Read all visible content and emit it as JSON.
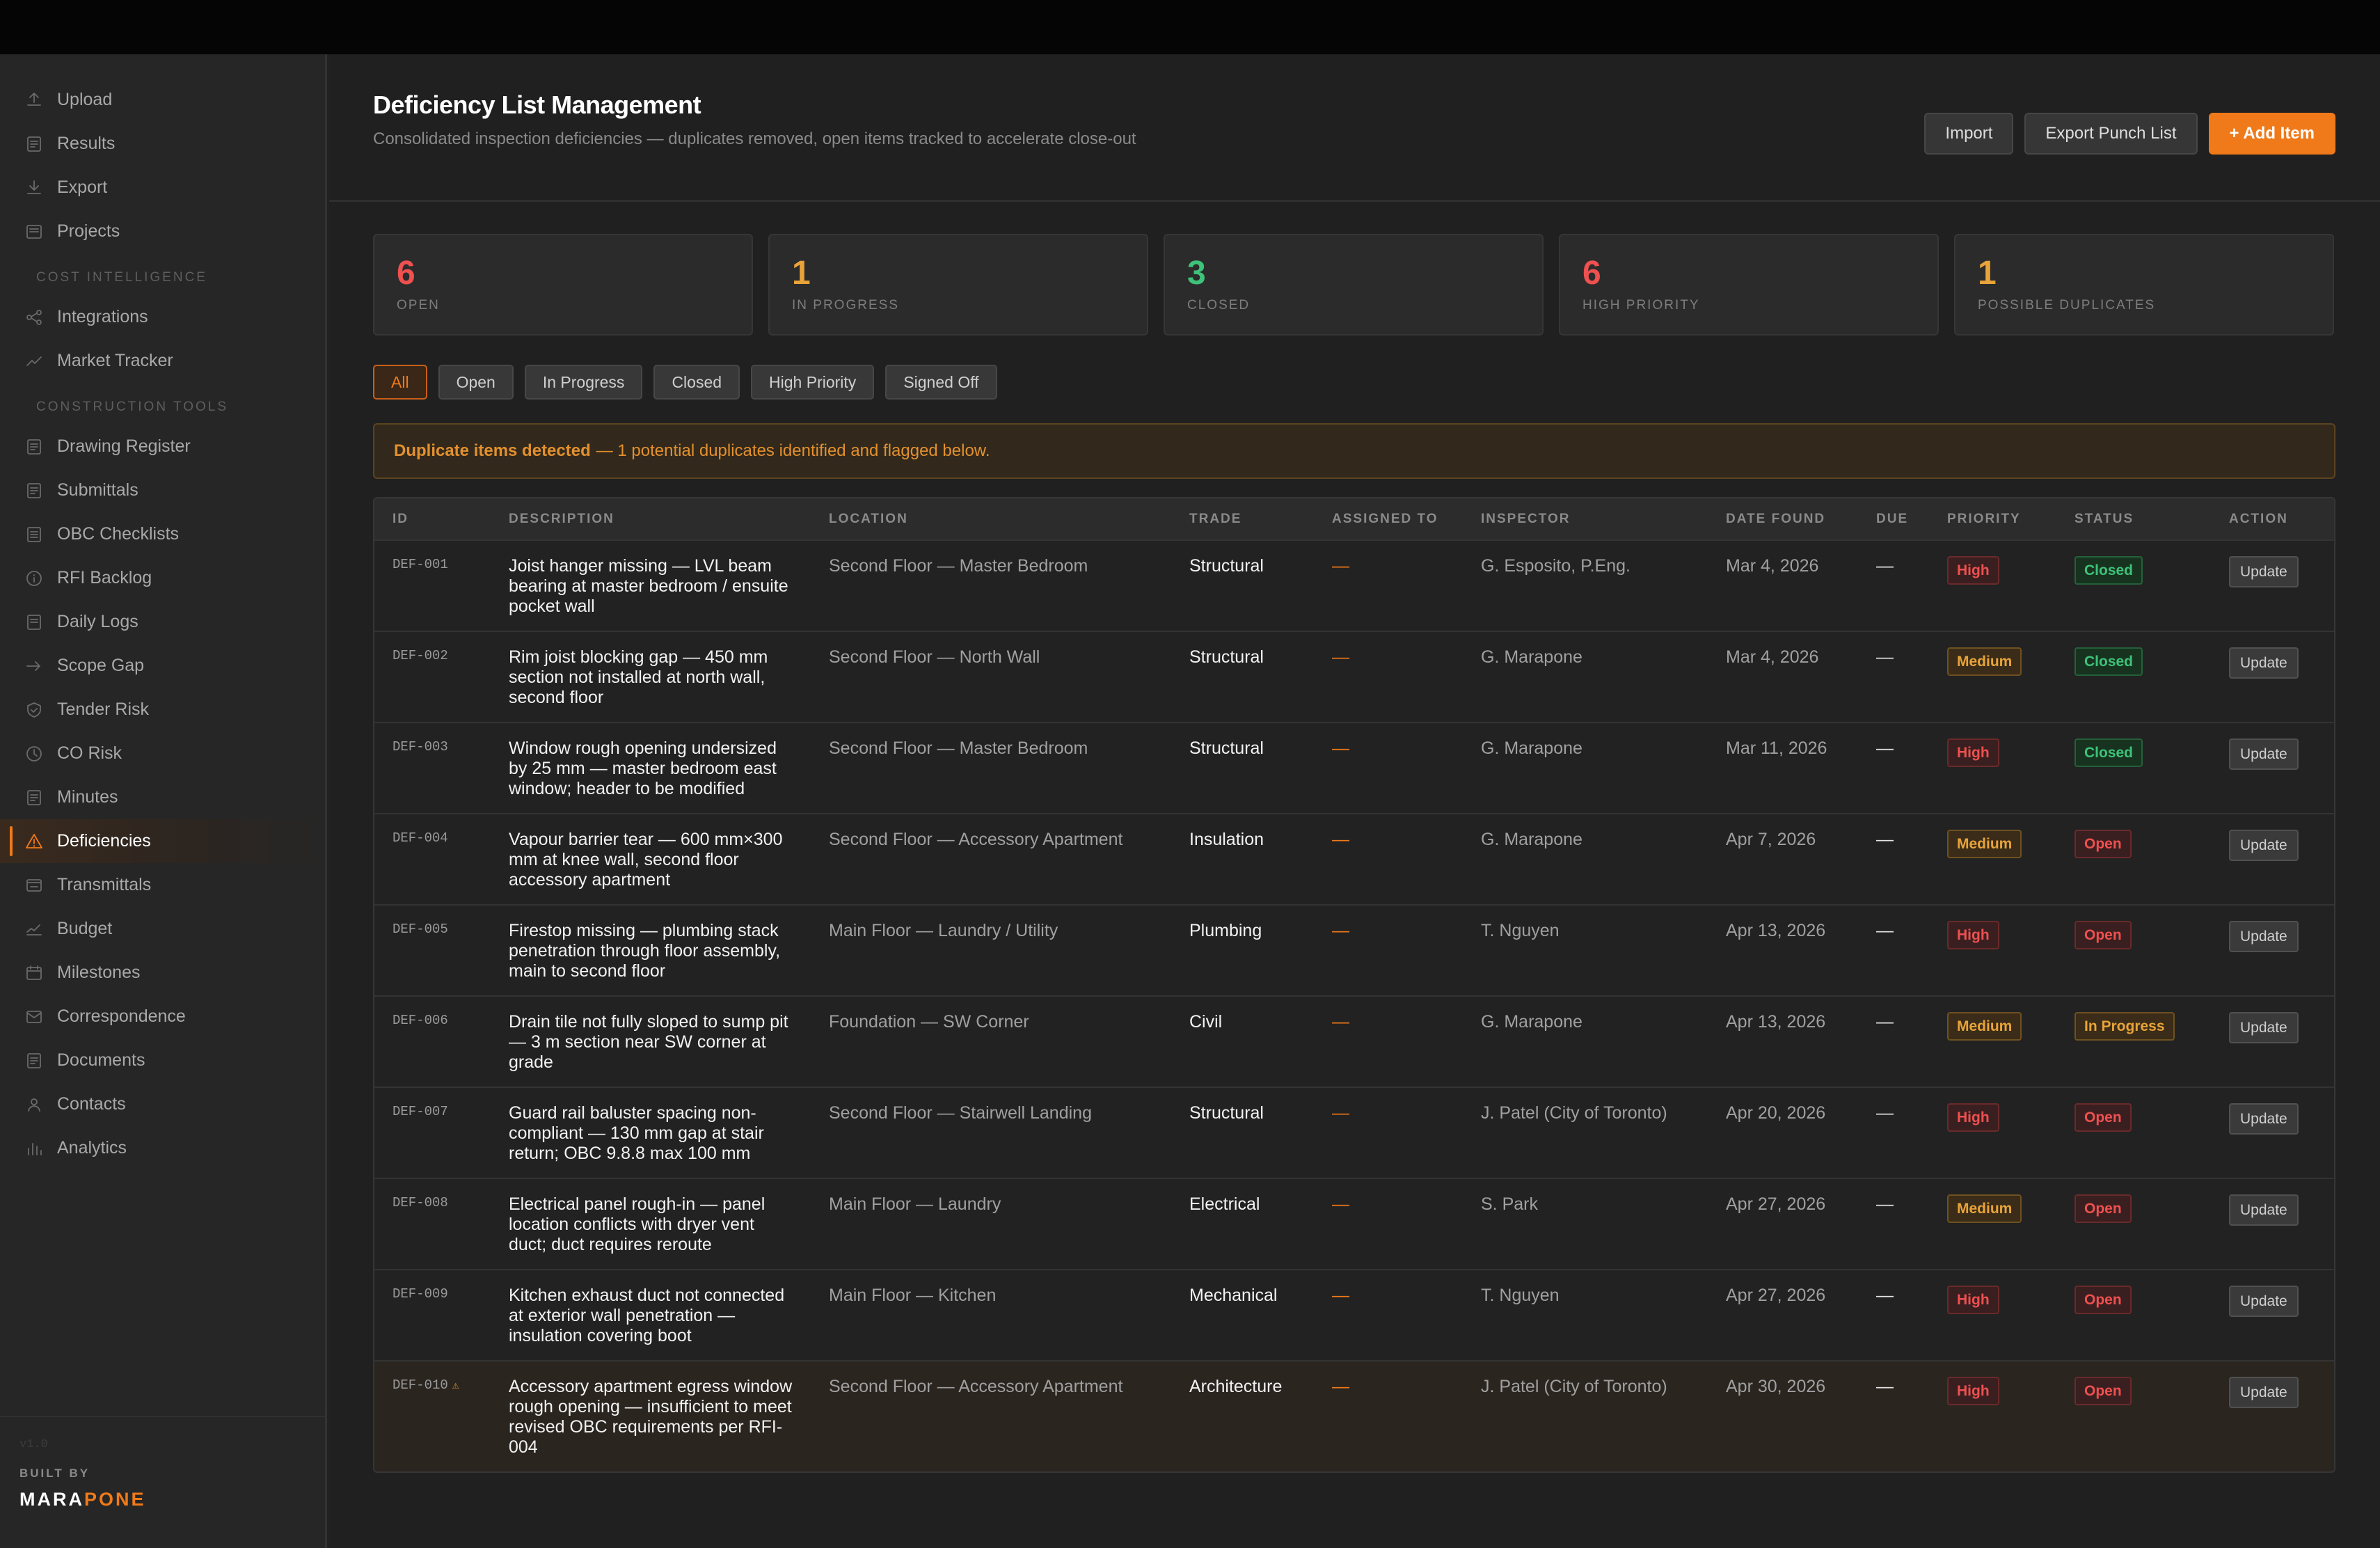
{
  "sidebar": {
    "top_items": [
      {
        "label": "Upload",
        "icon": "upload-icon"
      },
      {
        "label": "Results",
        "icon": "results-icon"
      },
      {
        "label": "Export",
        "icon": "export-icon"
      },
      {
        "label": "Projects",
        "icon": "projects-icon"
      }
    ],
    "section_cost": "COST INTELLIGENCE",
    "cost_items": [
      {
        "label": "Integrations",
        "icon": "integrations-icon"
      },
      {
        "label": "Market Tracker",
        "icon": "trend-icon"
      }
    ],
    "section_tools": "CONSTRUCTION TOOLS",
    "tool_items": [
      {
        "label": "Drawing Register",
        "icon": "document-icon"
      },
      {
        "label": "Submittals",
        "icon": "document-icon"
      },
      {
        "label": "OBC Checklists",
        "icon": "checklist-icon"
      },
      {
        "label": "RFI Backlog",
        "icon": "info-icon"
      },
      {
        "label": "Daily Logs",
        "icon": "log-icon"
      },
      {
        "label": "Scope Gap",
        "icon": "arrow-icon"
      },
      {
        "label": "Tender Risk",
        "icon": "shield-icon"
      },
      {
        "label": "CO Risk",
        "icon": "clock-icon"
      },
      {
        "label": "Minutes",
        "icon": "document-icon"
      },
      {
        "label": "Deficiencies",
        "icon": "warning-icon"
      },
      {
        "label": "Transmittals",
        "icon": "transmittal-icon"
      },
      {
        "label": "Budget",
        "icon": "chart-icon"
      },
      {
        "label": "Milestones",
        "icon": "calendar-icon"
      },
      {
        "label": "Correspondence",
        "icon": "mail-icon"
      },
      {
        "label": "Documents",
        "icon": "document-icon"
      },
      {
        "label": "Contacts",
        "icon": "person-icon"
      },
      {
        "label": "Analytics",
        "icon": "bar-chart-icon"
      }
    ],
    "active_label": "Deficiencies",
    "version": "v1.0",
    "built_by": "BUILT BY",
    "brand_part1": "MARA",
    "brand_part2": "PONE"
  },
  "header": {
    "title": "Deficiency List Management",
    "subtitle": "Consolidated inspection deficiencies — duplicates removed, open items tracked to accelerate close-out",
    "import_label": "Import",
    "export_label": "Export Punch List",
    "add_label": "+ Add Item"
  },
  "stats": [
    {
      "value": "6",
      "label": "OPEN",
      "color": "#ef5050"
    },
    {
      "value": "1",
      "label": "IN PROGRESS",
      "color": "#e8a33a"
    },
    {
      "value": "3",
      "label": "CLOSED",
      "color": "#3ec27a"
    },
    {
      "value": "6",
      "label": "HIGH PRIORITY",
      "color": "#ef5050"
    },
    {
      "value": "1",
      "label": "POSSIBLE DUPLICATES",
      "color": "#e8a33a"
    }
  ],
  "filters": [
    "All",
    "Open",
    "In Progress",
    "Closed",
    "High Priority",
    "Signed Off"
  ],
  "active_filter": "All",
  "alert": {
    "bold": "Duplicate items detected",
    "text": "— 1 potential duplicates identified and flagged below."
  },
  "table": {
    "columns": [
      "ID",
      "DESCRIPTION",
      "LOCATION",
      "TRADE",
      "ASSIGNED TO",
      "INSPECTOR",
      "DATE FOUND",
      "DUE",
      "PRIORITY",
      "STATUS",
      "ACTION"
    ],
    "rows": [
      {
        "id": "DEF-001",
        "desc": "Joist hanger missing — LVL beam bearing at master bedroom / ensuite pocket wall",
        "location": "Second Floor — Master Bedroom",
        "trade": "Structural",
        "assigned": "—",
        "inspector": "G. Esposito, P.Eng.",
        "date": "Mar 4, 2026",
        "due": "—",
        "priority": "High",
        "status": "Closed",
        "action": "Update",
        "duplicate": false
      },
      {
        "id": "DEF-002",
        "desc": "Rim joist blocking gap — 450 mm section not installed at north wall, second floor",
        "location": "Second Floor — North Wall",
        "trade": "Structural",
        "assigned": "—",
        "inspector": "G. Marapone",
        "date": "Mar 4, 2026",
        "due": "—",
        "priority": "Medium",
        "status": "Closed",
        "action": "Update",
        "duplicate": false
      },
      {
        "id": "DEF-003",
        "desc": "Window rough opening undersized by 25 mm — master bedroom east window; header to be modified",
        "location": "Second Floor — Master Bedroom",
        "trade": "Structural",
        "assigned": "—",
        "inspector": "G. Marapone",
        "date": "Mar 11, 2026",
        "due": "—",
        "priority": "High",
        "status": "Closed",
        "action": "Update",
        "duplicate": false
      },
      {
        "id": "DEF-004",
        "desc": "Vapour barrier tear — 600 mm×300 mm at knee wall, second floor accessory apartment",
        "location": "Second Floor — Accessory Apartment",
        "trade": "Insulation",
        "assigned": "—",
        "inspector": "G. Marapone",
        "date": "Apr 7, 2026",
        "due": "—",
        "priority": "Medium",
        "status": "Open",
        "action": "Update",
        "duplicate": false
      },
      {
        "id": "DEF-005",
        "desc": "Firestop missing — plumbing stack penetration through floor assembly, main to second floor",
        "location": "Main Floor — Laundry / Utility",
        "trade": "Plumbing",
        "assigned": "—",
        "inspector": "T. Nguyen",
        "date": "Apr 13, 2026",
        "due": "—",
        "priority": "High",
        "status": "Open",
        "action": "Update",
        "duplicate": false
      },
      {
        "id": "DEF-006",
        "desc": "Drain tile not fully sloped to sump pit — 3 m section near SW corner at grade",
        "location": "Foundation — SW Corner",
        "trade": "Civil",
        "assigned": "—",
        "inspector": "G. Marapone",
        "date": "Apr 13, 2026",
        "due": "—",
        "priority": "Medium",
        "status": "In Progress",
        "action": "Update",
        "duplicate": false
      },
      {
        "id": "DEF-007",
        "desc": "Guard rail baluster spacing non-compliant — 130 mm gap at stair return; OBC 9.8.8 max 100 mm",
        "location": "Second Floor — Stairwell Landing",
        "trade": "Structural",
        "assigned": "—",
        "inspector": "J. Patel (City of Toronto)",
        "date": "Apr 20, 2026",
        "due": "—",
        "priority": "High",
        "status": "Open",
        "action": "Update",
        "duplicate": false
      },
      {
        "id": "DEF-008",
        "desc": "Electrical panel rough-in — panel location conflicts with dryer vent duct; duct requires reroute",
        "location": "Main Floor — Laundry",
        "trade": "Electrical",
        "assigned": "—",
        "inspector": "S. Park",
        "date": "Apr 27, 2026",
        "due": "—",
        "priority": "Medium",
        "status": "Open",
        "action": "Update",
        "duplicate": false
      },
      {
        "id": "DEF-009",
        "desc": "Kitchen exhaust duct not connected at exterior wall penetration — insulation covering boot",
        "location": "Main Floor — Kitchen",
        "trade": "Mechanical",
        "assigned": "—",
        "inspector": "T. Nguyen",
        "date": "Apr 27, 2026",
        "due": "—",
        "priority": "High",
        "status": "Open",
        "action": "Update",
        "duplicate": false
      },
      {
        "id": "DEF-010",
        "desc": "Accessory apartment egress window rough opening — insufficient to meet revised OBC requirements per RFI-004",
        "location": "Second Floor — Accessory Apartment",
        "trade": "Architecture",
        "assigned": "—",
        "inspector": "J. Patel (City of Toronto)",
        "date": "Apr 30, 2026",
        "due": "—",
        "priority": "High",
        "status": "Open",
        "action": "Update",
        "duplicate": true
      }
    ]
  }
}
